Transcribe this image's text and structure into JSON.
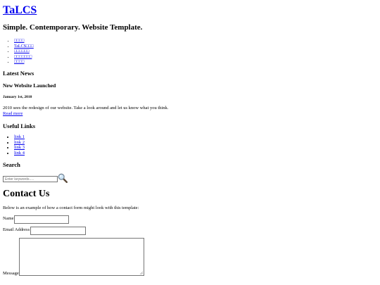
{
  "site": {
    "title": "TaLCS",
    "tagline": "Simple. Contemporary. Website Template."
  },
  "nav": {
    "items": [
      {
        "label": "□□□□"
      },
      {
        "label": "TaLCS□□□"
      },
      {
        "label": "□□□□□□"
      },
      {
        "label": "□□□□□□□"
      },
      {
        "label": "□□□□"
      }
    ]
  },
  "sidebar": {
    "latest_news": {
      "heading": "Latest News",
      "item_title": "New Website Launched",
      "date": "January 1st, 2010",
      "body": "2010 sees the redesign of our website. Take a look around and let us know what you think.",
      "read_more": "Read more"
    },
    "useful_links": {
      "heading": "Useful Links",
      "links": [
        {
          "label": "link 1"
        },
        {
          "label": "link 2"
        },
        {
          "label": "link 3"
        },
        {
          "label": "link 4"
        }
      ]
    },
    "search": {
      "heading": "Search",
      "placeholder": "Enter keywords.....",
      "button_icon": "magnifier-icon"
    }
  },
  "contact": {
    "heading": "Contact Us",
    "intro": "Below is an example of how a contact form might look with this template:",
    "name_label": "Name",
    "email_label": "Email Address",
    "message_label": "Message"
  }
}
